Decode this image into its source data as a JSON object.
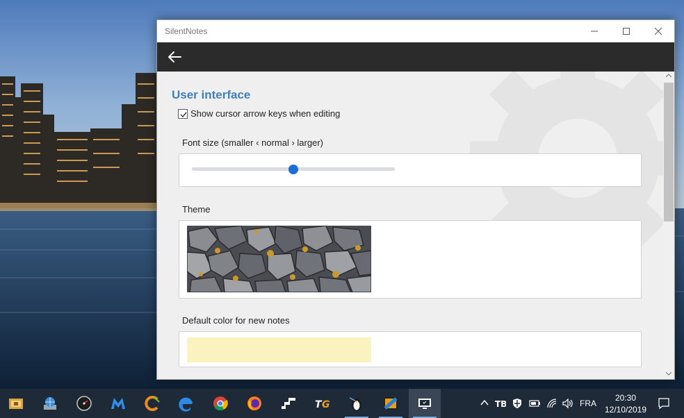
{
  "window": {
    "title": "SilentNotes"
  },
  "settings": {
    "section_title": "User interface",
    "cursor_keys": {
      "label": "Show cursor arrow keys when editing",
      "checked": true
    },
    "font_size": {
      "label": "Font size (smaller ‹ normal › larger)",
      "value": 0.5
    },
    "theme": {
      "label": "Theme"
    },
    "note_color": {
      "label": "Default color for new notes",
      "color": "#fbf3bf"
    }
  },
  "colors": {
    "accent": "#3f7fba",
    "toolbar": "#2b2b2b",
    "slider_thumb": "#1a6fd6"
  },
  "taskbar": {
    "apps": [
      {
        "name": "file-manager-icon"
      },
      {
        "name": "network-globe-icon"
      },
      {
        "name": "speedometer-icon"
      },
      {
        "name": "malwarebytes-icon"
      },
      {
        "name": "ccleaner-icon"
      },
      {
        "name": "edge-icon"
      },
      {
        "name": "chrome-icon"
      },
      {
        "name": "firefox-icon"
      },
      {
        "name": "stairs-app-icon"
      },
      {
        "name": "tg-app-icon"
      },
      {
        "name": "penguin-app-icon"
      },
      {
        "name": "video-editor-icon"
      },
      {
        "name": "silentnotes-icon"
      }
    ],
    "language": "FRA",
    "time": "20:30",
    "date": "12/10/2019"
  }
}
